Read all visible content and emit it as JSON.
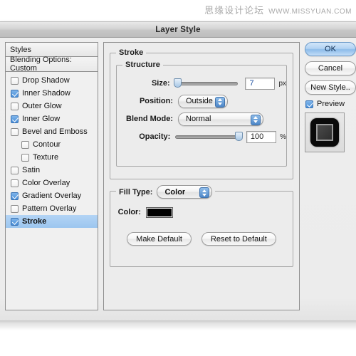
{
  "watermark": {
    "chinese": "思缘设计论坛",
    "url": "WWW.MISSYUAN.COM"
  },
  "window": {
    "title": "Layer Style"
  },
  "styles_panel": {
    "header": "Styles",
    "blending_options": "Blending Options: Custom",
    "items": [
      {
        "label": "Drop Shadow",
        "checked": false,
        "indent": false,
        "selected": false
      },
      {
        "label": "Inner Shadow",
        "checked": true,
        "indent": false,
        "selected": false
      },
      {
        "label": "Outer Glow",
        "checked": false,
        "indent": false,
        "selected": false
      },
      {
        "label": "Inner Glow",
        "checked": true,
        "indent": false,
        "selected": false
      },
      {
        "label": "Bevel and Emboss",
        "checked": false,
        "indent": false,
        "selected": false
      },
      {
        "label": "Contour",
        "checked": false,
        "indent": true,
        "selected": false
      },
      {
        "label": "Texture",
        "checked": false,
        "indent": true,
        "selected": false
      },
      {
        "label": "Satin",
        "checked": false,
        "indent": false,
        "selected": false
      },
      {
        "label": "Color Overlay",
        "checked": false,
        "indent": false,
        "selected": false
      },
      {
        "label": "Gradient Overlay",
        "checked": true,
        "indent": false,
        "selected": false
      },
      {
        "label": "Pattern Overlay",
        "checked": false,
        "indent": false,
        "selected": false
      },
      {
        "label": "Stroke",
        "checked": true,
        "indent": false,
        "selected": true
      }
    ]
  },
  "main": {
    "group_title": "Stroke",
    "structure": {
      "title": "Structure",
      "size": {
        "label": "Size:",
        "value": "7",
        "unit": "px",
        "slider_percent": 4
      },
      "position": {
        "label": "Position:",
        "value": "Outside"
      },
      "blend_mode": {
        "label": "Blend Mode:",
        "value": "Normal"
      },
      "opacity": {
        "label": "Opacity:",
        "value": "100",
        "unit": "%",
        "slider_percent": 100
      }
    },
    "fill_type": {
      "label": "Fill Type:",
      "value": "Color",
      "color_label": "Color:",
      "color_value": "#000000"
    },
    "buttons": {
      "make_default": "Make Default",
      "reset_to_default": "Reset to Default"
    }
  },
  "right_column": {
    "ok": "OK",
    "cancel": "Cancel",
    "new_style": "New Style..",
    "preview_label": "Preview",
    "preview_checked": true
  },
  "colors": {
    "selection_blue": "#9cc6ef",
    "default_button_blue": "#8dbcea",
    "checkbox_blue": "#4a8fd8",
    "swatch_black": "#000000"
  }
}
